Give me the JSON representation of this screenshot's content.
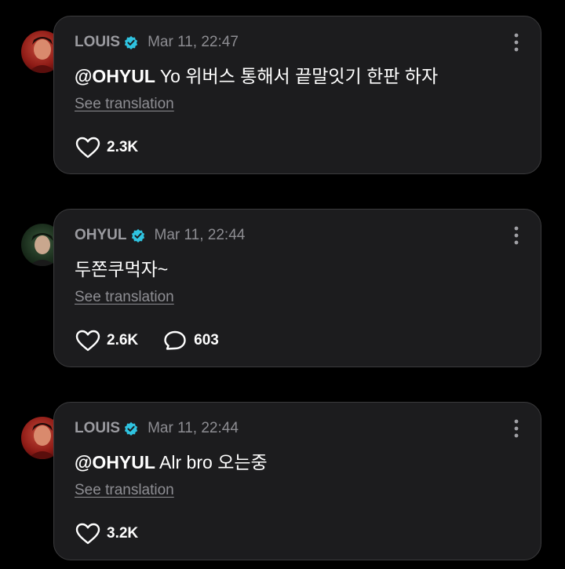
{
  "posts": [
    {
      "author": "LOUIS",
      "verified": true,
      "time": "Mar 11, 22:47",
      "mention": "@OHYUL",
      "text": " Yo 위버스 통해서 끝말잇기 한판 하자",
      "translate": "See translation",
      "likes": "2.3K",
      "comments": null,
      "avatar": "louis"
    },
    {
      "author": "OHYUL",
      "verified": true,
      "time": "Mar 11, 22:44",
      "mention": "",
      "text": "두쫀쿠먹자~",
      "translate": "See translation",
      "likes": "2.6K",
      "comments": "603",
      "avatar": "ohyul"
    },
    {
      "author": "LOUIS",
      "verified": true,
      "time": "Mar 11, 22:44",
      "mention": "@OHYUL",
      "text": " Alr bro 오는중",
      "translate": "See translation",
      "likes": "3.2K",
      "comments": null,
      "avatar": "louis"
    }
  ],
  "icons": {
    "verified": "verified-badge-icon",
    "more": "more-vertical-icon",
    "like": "heart-icon",
    "comment": "comment-bubble-icon"
  },
  "colors": {
    "background": "#000000",
    "card": "#1c1c1e",
    "card_border": "#3b3b3d",
    "name": "#9b9ba0",
    "meta": "#8d8d92",
    "badge": "#2fc3e0"
  }
}
